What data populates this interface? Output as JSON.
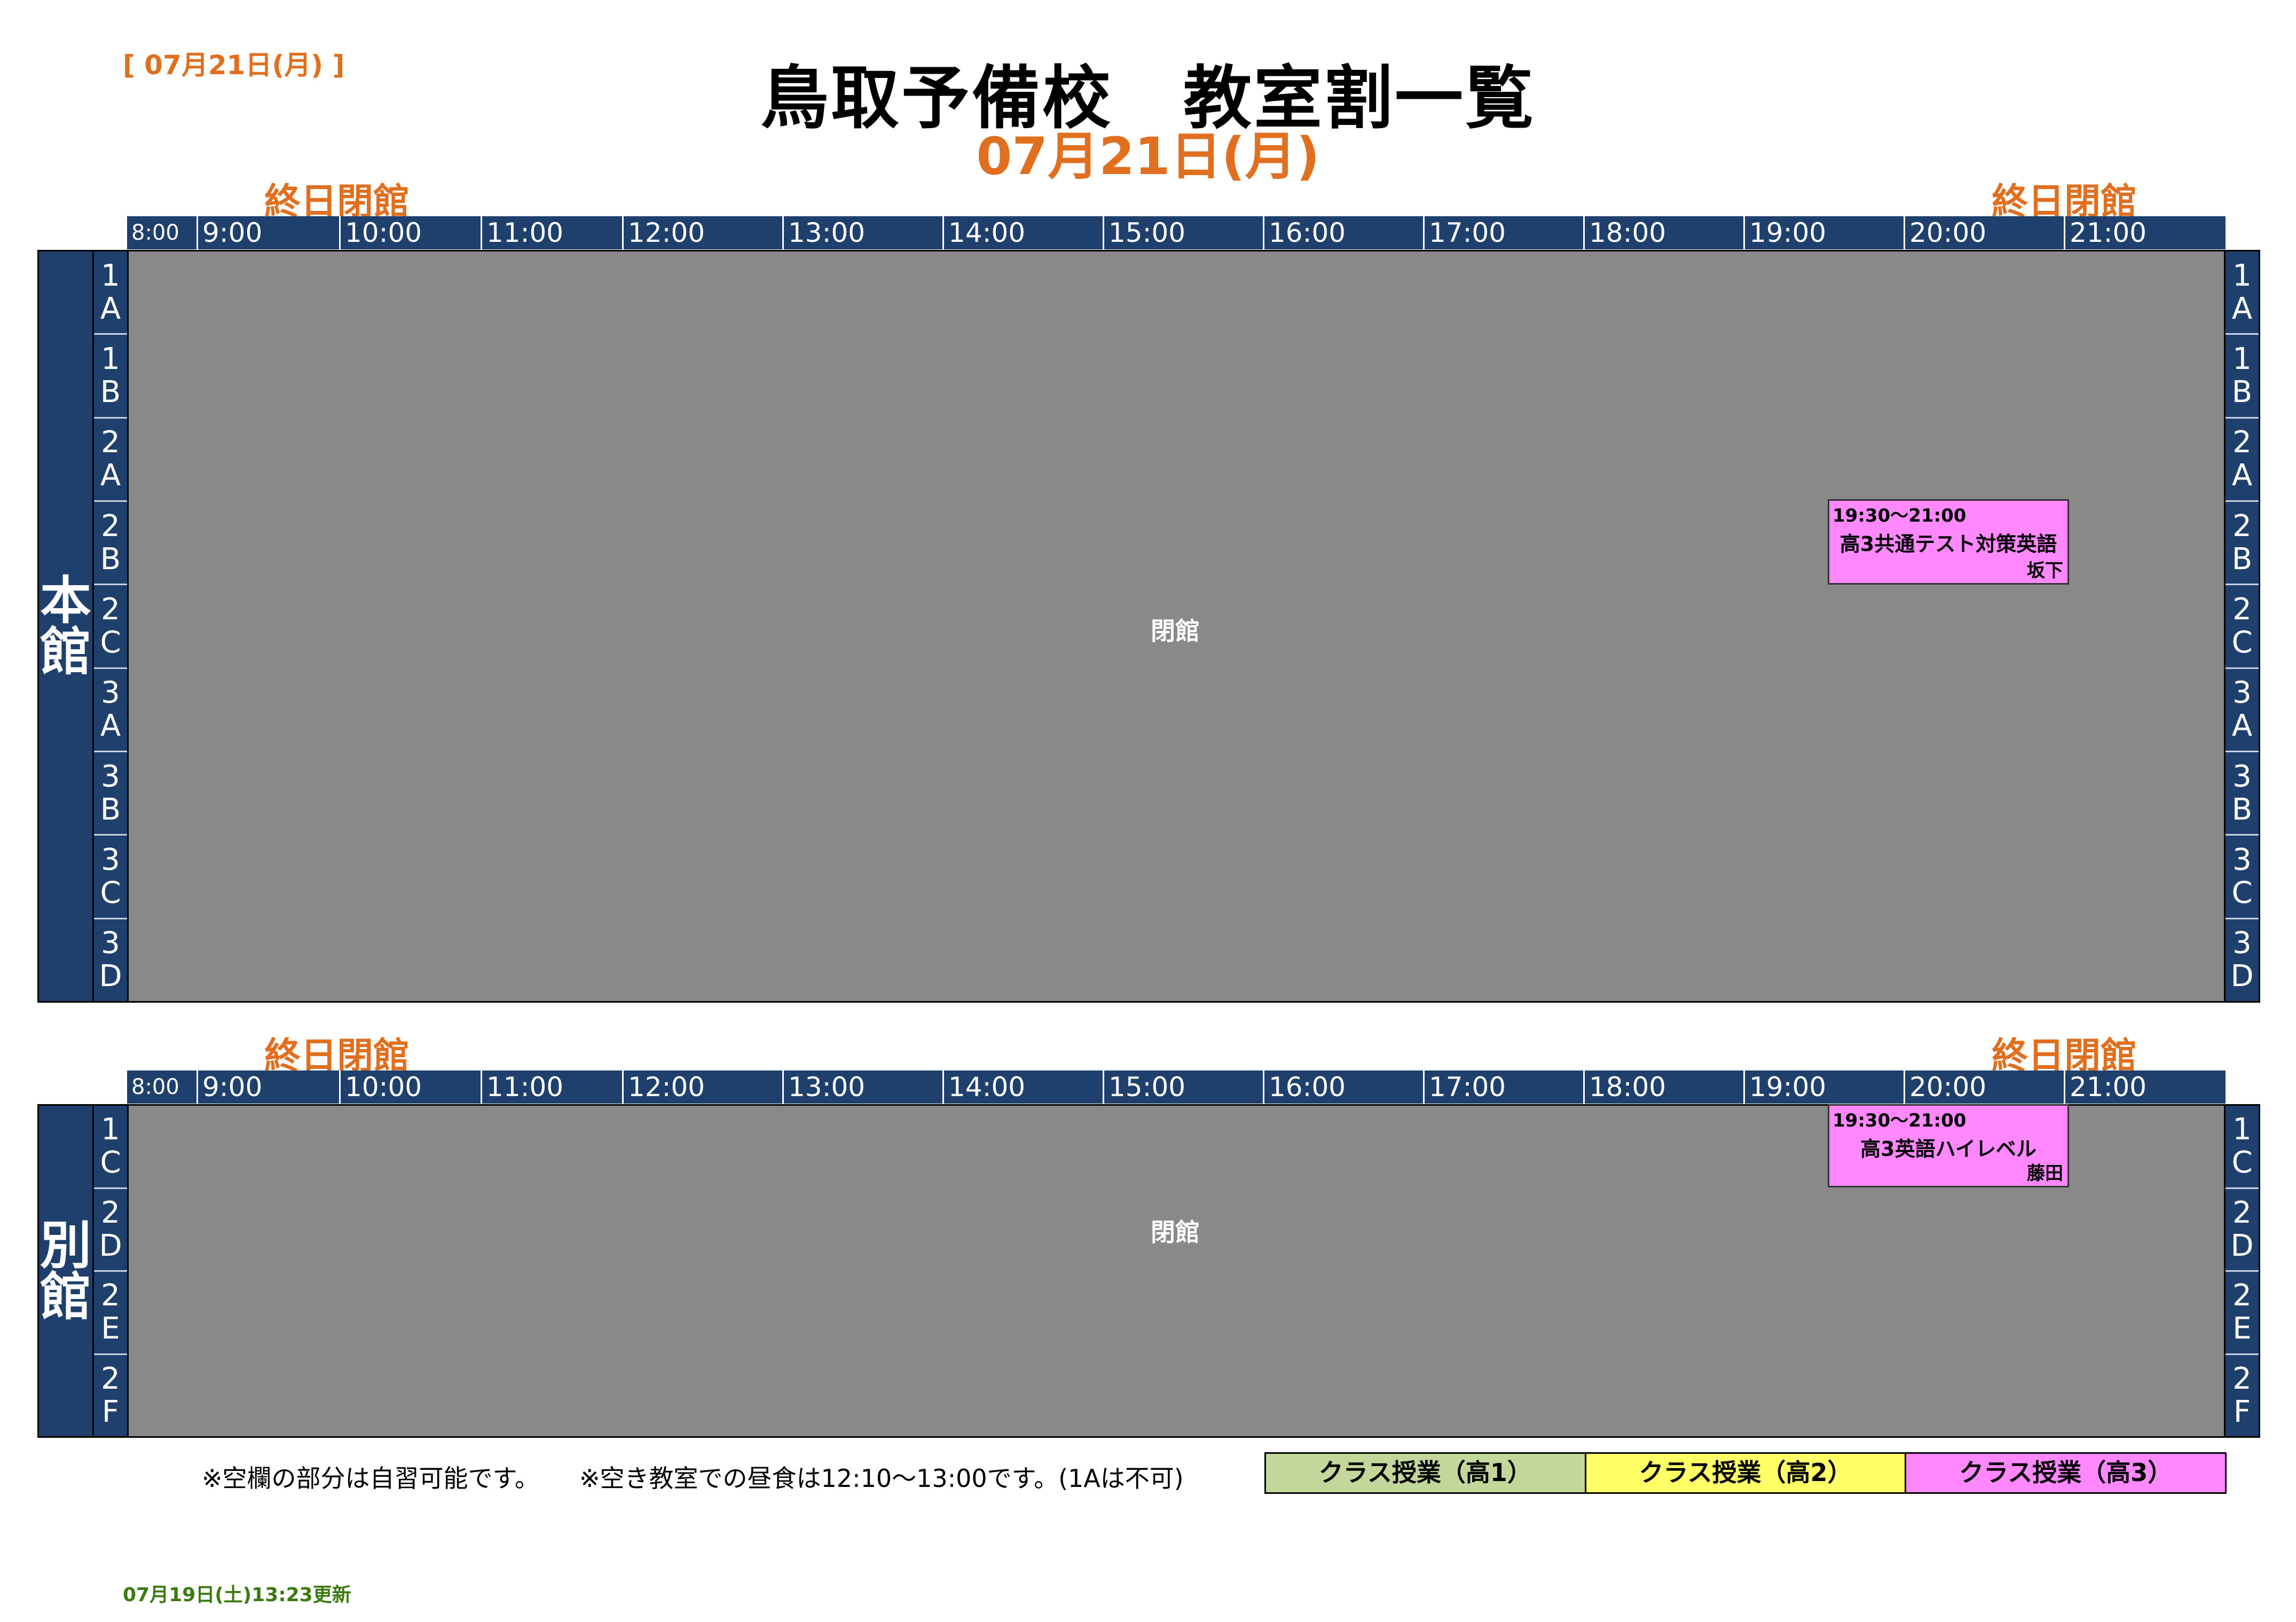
{
  "header": {
    "date_small": "[ 07月21日(月) ]",
    "title": "鳥取予備校　教室割一覧",
    "date_large": "07月21日(月)"
  },
  "closed_note": "終日閉館",
  "closed_label": "閉館",
  "timeline": [
    "8:00",
    "9:00",
    "10:00",
    "11:00",
    "12:00",
    "13:00",
    "14:00",
    "15:00",
    "16:00",
    "17:00",
    "18:00",
    "19:00",
    "20:00",
    "21:00"
  ],
  "main_building": {
    "name_chars": [
      "本",
      "館"
    ],
    "rooms": [
      [
        "1",
        "A"
      ],
      [
        "1",
        "B"
      ],
      [
        "2",
        "A"
      ],
      [
        "2",
        "B"
      ],
      [
        "2",
        "C"
      ],
      [
        "3",
        "A"
      ],
      [
        "3",
        "B"
      ],
      [
        "3",
        "C"
      ],
      [
        "3",
        "D"
      ]
    ],
    "event": {
      "time": "19:30〜21:00",
      "name": "高3共通テスト対策英語",
      "person": "坂下",
      "room": "2B"
    }
  },
  "annex_building": {
    "name_chars": [
      "別",
      "館"
    ],
    "rooms": [
      [
        "1",
        "C"
      ],
      [
        "2",
        "D"
      ],
      [
        "2",
        "E"
      ],
      [
        "2",
        "F"
      ]
    ],
    "event": {
      "time": "19:30〜21:00",
      "name": "高3英語ハイレベル",
      "person": "藤田",
      "room": "1C"
    }
  },
  "notes": {
    "note1": "※空欄の部分は自習可能です。",
    "note2": "※空き教室での昼食は12:10〜13:00です。(1Aは不可)"
  },
  "legend": [
    {
      "label": "クラス授業（高1）",
      "color": "#c4d79b"
    },
    {
      "label": "クラス授業（高2）",
      "color": "#ffff66"
    },
    {
      "label": "クラス授業（高3）",
      "color": "#ff88ff"
    }
  ],
  "updated": "07月19日(土)13:23更新",
  "colors": {
    "accent": "#e07020",
    "header_bg": "#1f3f6c",
    "closed_bg": "#898989"
  }
}
